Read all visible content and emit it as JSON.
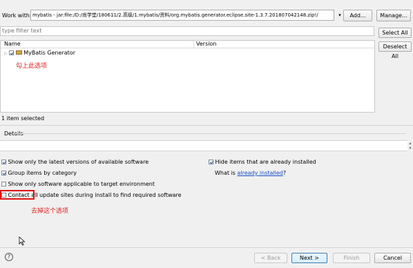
{
  "work_with": {
    "label": "Work with:",
    "value": "mybatis - jar:file:/D:/尚学堂/180611/2.高级/1.mybatis/资料/org.mybatis.generator.eclipse.site-1.3.7.201807042148.zip!/",
    "add_label": "Add...",
    "manage_label": "Manage..."
  },
  "filter": {
    "placeholder": "type filter text"
  },
  "side_buttons": {
    "select_all": "Select All",
    "deselect_all": "Deselect All"
  },
  "table": {
    "col_name": "Name",
    "col_version": "Version",
    "items": [
      {
        "label": "MyBatis Generator",
        "checked": true
      }
    ],
    "annotation": "勾上此选项"
  },
  "status": "1 item selected",
  "details": {
    "label": "Details"
  },
  "options": {
    "show_latest": "Show only the latest versions of available software",
    "group_items": "Group items by category",
    "show_applicable": "Show only software applicable to target environment",
    "contact_all": "Contact all update sites during install to find required software",
    "hide_installed": "Hide items that are already installed",
    "what_is_prefix": "What is ",
    "what_is_link": "already installed",
    "what_is_suffix": "?",
    "annotation": "去掉这个选项"
  },
  "footer": {
    "back": "< Back",
    "next": "Next >",
    "finish": "Finish",
    "cancel": "Cancel"
  },
  "colors": {
    "annotation_red": "#e02020",
    "link_blue": "#1a4ec7"
  },
  "icons": [
    "dropdown-arrow-icon",
    "expand-arrow-icon",
    "package-icon",
    "help-icon",
    "mouse-cursor-icon",
    "scroll-arrows-icon"
  ]
}
